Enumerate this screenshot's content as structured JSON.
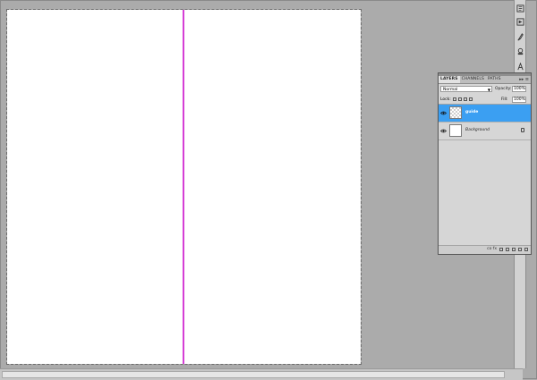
{
  "layers_panel": {
    "tabs": [
      "LAYERS",
      "CHANNELS",
      "PATHS"
    ],
    "active_tab": "LAYERS",
    "menu_glyph": "▸▸  ≡",
    "blend_mode": "Normal",
    "opacity_label": "Opacity:",
    "opacity_value": "100%",
    "lock_label": "Lock:",
    "fill_label": "Fill:",
    "fill_value": "100%",
    "layers": [
      {
        "name": "guide",
        "selected": true,
        "thumbnail": "transparent-checker"
      },
      {
        "name": "Background",
        "selected": false,
        "thumbnail": "white",
        "locked": true
      }
    ],
    "footer_link_label": "co fx"
  },
  "canvas": {
    "background": "#ffffff",
    "guide_color": "#d63fd6"
  },
  "toolstrip": {
    "icons": [
      "history-icon",
      "actions-icon",
      "brush-icon",
      "clone-source-icon",
      "character-icon"
    ]
  },
  "colors": {
    "workspace": "#ababab",
    "selection": "#3b9ff2"
  }
}
